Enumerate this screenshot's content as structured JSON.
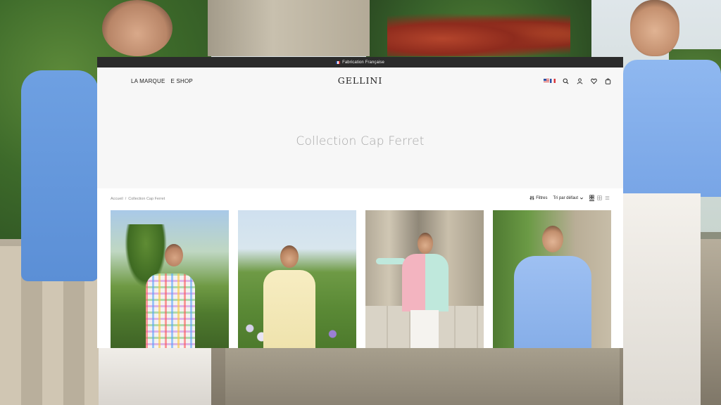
{
  "announcement": {
    "text": "Fabrication Française"
  },
  "nav": {
    "items": [
      "LA MARQUE",
      "E SHOP"
    ]
  },
  "brand": {
    "logo": "GELLINI"
  },
  "header_icons": [
    "flag-us-icon",
    "flag-fr-icon",
    "search-icon",
    "user-icon",
    "heart-icon",
    "bag-icon"
  ],
  "hero": {
    "title": "Collection Cap Ferret"
  },
  "breadcrumb": {
    "home": "Accueil",
    "separator": "/",
    "current": "Collection Cap Ferret"
  },
  "toolbar": {
    "filters_label": "Filtres",
    "sort_label": "Tri par défaut",
    "view_options": [
      "grid-4-icon",
      "grid-2-icon",
      "list-icon"
    ],
    "active_view": "grid-4-icon"
  },
  "products": [
    {
      "description": "multicolor check shirt"
    },
    {
      "description": "yellow shirt"
    },
    {
      "description": "pink and mint shirt"
    },
    {
      "description": "blue shirt"
    }
  ],
  "colors": {
    "announcement_bg": "#2b2b2b",
    "header_bg": "#f7f7f7",
    "hero_title": "#a7a7a7",
    "text_dark": "#222222"
  }
}
